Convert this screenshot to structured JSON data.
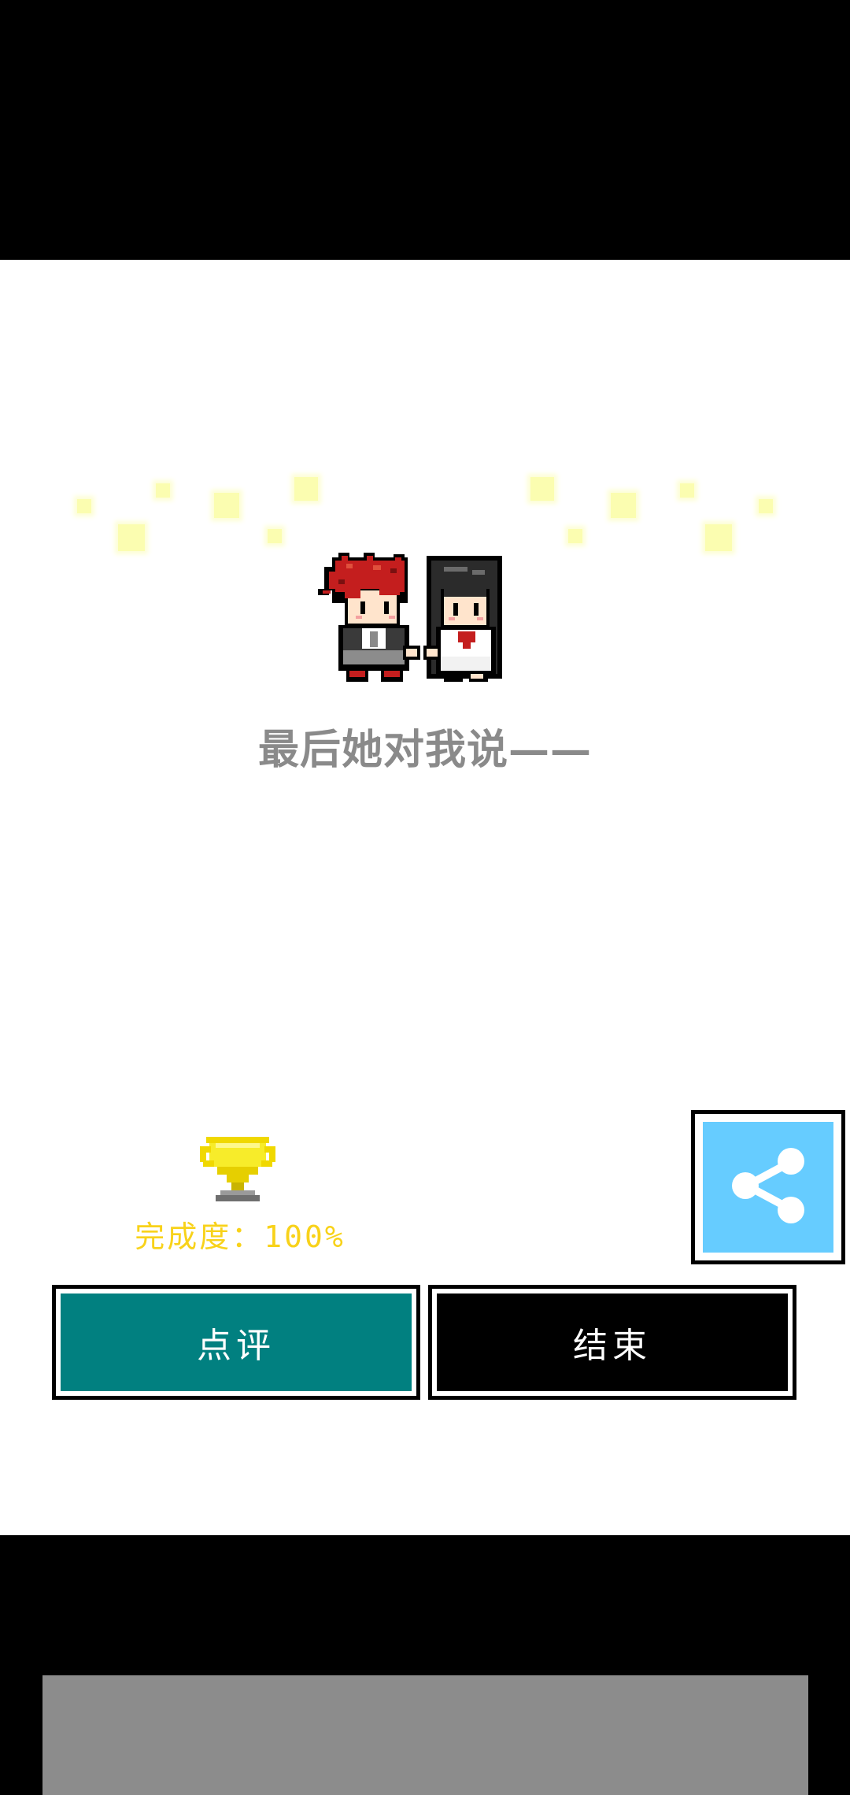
{
  "scene": {
    "ending_text": "最后她对我说——"
  },
  "result": {
    "completion_label": "完成度：100%",
    "completion_percent": 100,
    "trophy_icon": "trophy-icon"
  },
  "actions": {
    "review_label": "点评",
    "end_label": "结束",
    "share_icon": "share-icon"
  },
  "colors": {
    "review_button": "#018080",
    "end_button": "#000000",
    "share_button": "#66ccff",
    "completion_text": "#f8d21a",
    "ending_text": "#8a8a8a",
    "ad_banner": "#8c8c8c"
  }
}
